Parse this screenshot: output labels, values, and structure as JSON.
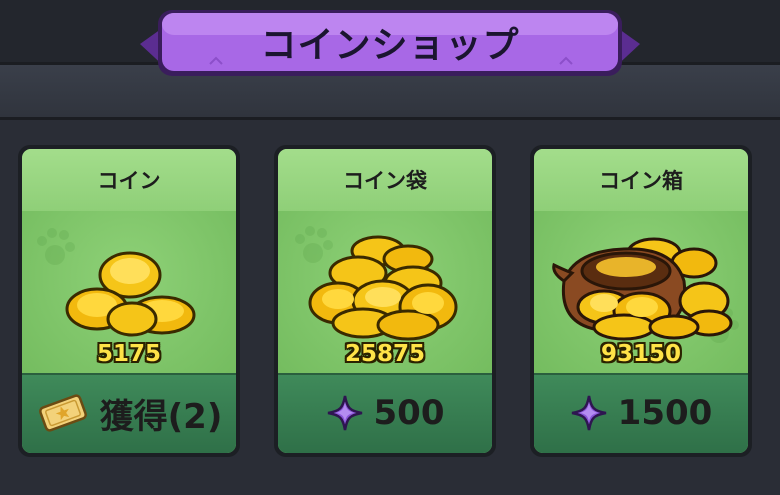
{
  "title": "コインショップ",
  "items": [
    {
      "name": "コイン",
      "amount": "5175",
      "price": "獲得(2)",
      "price_icon": "ticket-icon"
    },
    {
      "name": "コイン袋",
      "amount": "25875",
      "price": "500",
      "price_icon": "purple-gem-icon"
    },
    {
      "name": "コイン箱",
      "amount": "93150",
      "price": "1500",
      "price_icon": "purple-gem-icon"
    }
  ],
  "colors": {
    "banner": "#9b5ad9",
    "card_green": "#7fc46a",
    "coin_gold": "#f5c518",
    "gem_purple": "#7a45c9"
  }
}
